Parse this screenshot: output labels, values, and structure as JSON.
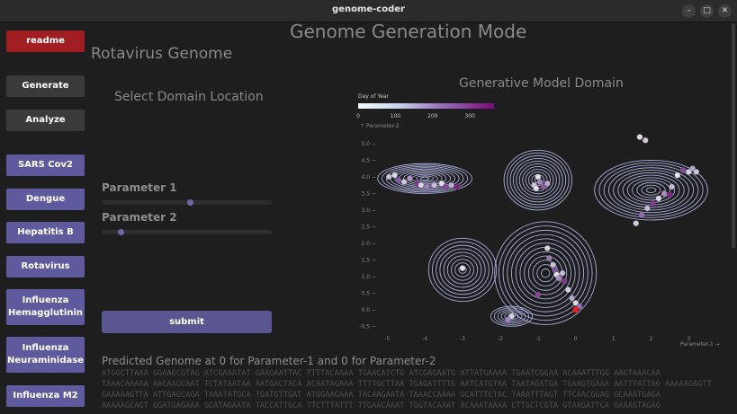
{
  "window": {
    "title": "genome-coder",
    "controls": [
      "–",
      "□",
      "✕"
    ]
  },
  "sidebar": {
    "readme": "readme",
    "generate": "Generate",
    "analyze": "Analyze",
    "viruses": [
      "SARS Cov2",
      "Dengue",
      "Hepatitis B",
      "Rotavirus",
      "Influenza Hemagglutinin",
      "Influenza Neuraminidase",
      "Influenza M2"
    ]
  },
  "main": {
    "title": "Genome Generation Mode",
    "genome_title": "Rotavirus Genome",
    "select_heading": "Select Domain Location",
    "domain_heading": "Generative Model Domain",
    "param1_label": "Parameter 1",
    "param1_value": 0.52,
    "param2_label": "Parameter 2",
    "param2_value": 0.1,
    "submit_label": "submit",
    "predicted_label": "Predicted Genome at 0 for Parameter-1 and 0 for Parameter-2",
    "sequence_lines": [
      "ATGGCTTAAA GGAAGCGTAG ATCGAAATAT GAAGAATTAC TTTTACAAAA TGAACATCTG ATCGAGAATG ATTATGAAAA TGAATCGGAA ACAAATTTGG AAGTAAACAA",
      "TAAACAAAAA AACAAGCAAT TCTATAATAA AATGACTACA ACAATAGAAA TTTTGCTTAA TGAGATTTTG AATCATGTAA TAATAGATGA TGAAGTGAAA AATTTATTAG AAAAAGAGTT",
      "GAAAAAGTTA ATTGAGCAGA TAAATATGCA TGATGTTGAT ATGGAAGAAA TACAAGAATA TAAACCAAAA GCATTTCTAC TAAATTTAGT TTCAACGGAG GCAAATGAGA",
      "AAAAAGCAGT GGATGAGAAA GCATAGAATA TACCATTGCA TTCTTTATTT TTGAACAAAT TGGTACAAAT ACAAATAAAA CTTGCTCGTA GTAAGATTCA GAAAGTAGAG"
    ]
  },
  "chart_data": {
    "type": "scatter",
    "title": "",
    "colorbar": {
      "label": "Day of Year",
      "ticks": [
        0,
        100,
        200,
        300
      ]
    },
    "y_axis_label": "↑ Parameter-2",
    "x_axis_label": "Parameter-1 →",
    "x_ticks": [
      -5,
      -4,
      -3,
      -2,
      -1,
      0,
      1,
      2,
      3
    ],
    "y_ticks": [
      5.0,
      4.5,
      4.0,
      3.5,
      3.0,
      2.5,
      2.0,
      1.5,
      1.0,
      0.5,
      0.0,
      -0.5
    ],
    "xlim": [
      -5.1,
      3.3
    ],
    "ylim": [
      -0.6,
      5.35
    ],
    "grid": false,
    "contour_color": "#b8bdf0",
    "clusters": [
      {
        "x": -4.0,
        "y": 3.95,
        "sx": 1.25,
        "sy": 0.45,
        "levels": 11
      },
      {
        "x": -1.0,
        "y": 3.9,
        "sx": 0.9,
        "sy": 0.9,
        "levels": 11
      },
      {
        "x": 2.0,
        "y": 3.6,
        "sx": 1.5,
        "sy": 0.9,
        "levels": 12
      },
      {
        "x": -3.0,
        "y": 1.2,
        "sx": 0.9,
        "sy": 0.95,
        "levels": 9
      },
      {
        "x": -0.8,
        "y": 1.1,
        "sx": 1.35,
        "sy": 1.55,
        "levels": 12
      },
      {
        "x": -1.7,
        "y": -0.2,
        "sx": 0.55,
        "sy": 0.3,
        "levels": 6
      }
    ],
    "points": [
      {
        "x": -4.95,
        "y": 4.0,
        "d": 80
      },
      {
        "x": -4.8,
        "y": 4.05,
        "d": 30
      },
      {
        "x": -4.7,
        "y": 3.9,
        "d": 250
      },
      {
        "x": -4.55,
        "y": 3.85,
        "d": 60
      },
      {
        "x": -4.4,
        "y": 3.95,
        "d": 150
      },
      {
        "x": -4.2,
        "y": 3.8,
        "d": 310
      },
      {
        "x": -4.1,
        "y": 3.75,
        "d": 40
      },
      {
        "x": -3.95,
        "y": 3.7,
        "d": 200
      },
      {
        "x": -3.75,
        "y": 3.75,
        "d": 90
      },
      {
        "x": -3.55,
        "y": 3.8,
        "d": 20
      },
      {
        "x": -3.45,
        "y": 3.7,
        "d": 280
      },
      {
        "x": -3.3,
        "y": 3.75,
        "d": 110
      },
      {
        "x": -3.15,
        "y": 3.7,
        "d": 340
      },
      {
        "x": -1.0,
        "y": 4.0,
        "d": 10
      },
      {
        "x": -0.95,
        "y": 3.85,
        "d": 180
      },
      {
        "x": -1.1,
        "y": 3.75,
        "d": 60
      },
      {
        "x": -0.85,
        "y": 3.7,
        "d": 260
      },
      {
        "x": -0.75,
        "y": 3.8,
        "d": 120
      },
      {
        "x": -1.05,
        "y": 3.65,
        "d": 20
      },
      {
        "x": 1.6,
        "y": 2.6,
        "d": 50
      },
      {
        "x": 1.75,
        "y": 2.85,
        "d": 220
      },
      {
        "x": 1.9,
        "y": 3.05,
        "d": 80
      },
      {
        "x": 2.05,
        "y": 3.2,
        "d": 300
      },
      {
        "x": 2.2,
        "y": 3.35,
        "d": 30
      },
      {
        "x": 2.35,
        "y": 3.5,
        "d": 160
      },
      {
        "x": 2.55,
        "y": 3.7,
        "d": 90
      },
      {
        "x": 2.7,
        "y": 4.05,
        "d": 10
      },
      {
        "x": 2.85,
        "y": 4.2,
        "d": 270
      },
      {
        "x": 3.0,
        "y": 4.15,
        "d": 40
      },
      {
        "x": 3.1,
        "y": 4.25,
        "d": 130
      },
      {
        "x": 3.2,
        "y": 4.15,
        "d": 70
      },
      {
        "x": 1.7,
        "y": 5.2,
        "d": 20
      },
      {
        "x": 1.85,
        "y": 5.1,
        "d": 60
      },
      {
        "x": 2.5,
        "y": 3.45,
        "d": 320
      },
      {
        "x": -3.0,
        "y": 1.25,
        "d": 15
      },
      {
        "x": -0.75,
        "y": 1.85,
        "d": 40
      },
      {
        "x": -0.7,
        "y": 1.55,
        "d": 200
      },
      {
        "x": -0.6,
        "y": 1.35,
        "d": 70
      },
      {
        "x": -0.55,
        "y": 1.2,
        "d": 250
      },
      {
        "x": -0.5,
        "y": 1.05,
        "d": 10
      },
      {
        "x": -0.45,
        "y": 0.95,
        "d": 160
      },
      {
        "x": -0.35,
        "y": 1.1,
        "d": 90
      },
      {
        "x": -0.3,
        "y": 0.85,
        "d": 300
      },
      {
        "x": -0.2,
        "y": 0.6,
        "d": 50
      },
      {
        "x": -0.1,
        "y": 0.35,
        "d": 120
      },
      {
        "x": 0.0,
        "y": 0.2,
        "d": 30
      },
      {
        "x": 0.1,
        "y": 0.1,
        "d": 210
      },
      {
        "x": -1.0,
        "y": 0.45,
        "d": 280
      },
      {
        "x": -1.7,
        "y": -0.2,
        "d": 40
      },
      {
        "x": -1.8,
        "y": -0.3,
        "d": 180
      }
    ],
    "selected_point": {
      "x": 0.0,
      "y": 0.0,
      "color": "#e8202a"
    }
  }
}
